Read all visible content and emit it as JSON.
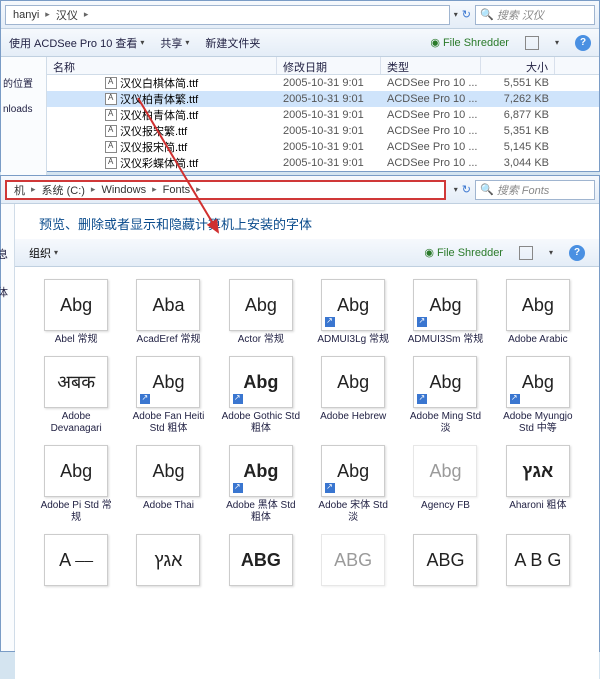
{
  "win1": {
    "path": [
      "hanyi",
      "汉仪"
    ],
    "search_placeholder": "搜索 汉仪",
    "toolbar": {
      "acd": "使用 ACDSee Pro 10 查看",
      "share": "共享",
      "new_folder": "新建文件夹",
      "shredder": "File Shredder"
    },
    "cols": {
      "name": "名称",
      "date": "修改日期",
      "type": "类型",
      "size": "大小"
    },
    "files": [
      {
        "name": "汉仪白棋体简.ttf",
        "date": "2005-10-31 9:01",
        "type": "ACDSee Pro 10 ...",
        "size": "5,551 KB",
        "sel": false
      },
      {
        "name": "汉仪柏青体繁.ttf",
        "date": "2005-10-31 9:01",
        "type": "ACDSee Pro 10 ...",
        "size": "7,262 KB",
        "sel": true
      },
      {
        "name": "汉仪柏青体简.ttf",
        "date": "2005-10-31 9:01",
        "type": "ACDSee Pro 10 ...",
        "size": "6,877 KB",
        "sel": false
      },
      {
        "name": "汉仪报宋繁.ttf",
        "date": "2005-10-31 9:01",
        "type": "ACDSee Pro 10 ...",
        "size": "5,351 KB",
        "sel": false
      },
      {
        "name": "汉仪报宋简.ttf",
        "date": "2005-10-31 9:01",
        "type": "ACDSee Pro 10 ...",
        "size": "5,145 KB",
        "sel": false
      },
      {
        "name": "汉仪彩蝶体简.ttf",
        "date": "2005-10-31 9:01",
        "type": "ACDSee Pro 10 ...",
        "size": "3,044 KB",
        "sel": false
      }
    ],
    "sidebar": [
      "的位置",
      "nloads"
    ]
  },
  "win2": {
    "path": [
      "机",
      "系统 (C:)",
      "Windows",
      "Fonts"
    ],
    "search_placeholder": "搜索 Fonts",
    "title": "预览、删除或者显示和隐藏计算机上安装的字体",
    "toolbar": {
      "organize": "组织",
      "shredder": "File Shredder"
    },
    "sidebar": [
      "息",
      "体"
    ],
    "fonts": [
      {
        "sample": "Abg",
        "name": "Abel 常规"
      },
      {
        "sample": "Aba",
        "name": "AcadEref 常规"
      },
      {
        "sample": "Abg",
        "name": "Actor 常规"
      },
      {
        "sample": "Abg",
        "name": "ADMUI3Lg 常规",
        "sc": true
      },
      {
        "sample": "Abg",
        "name": "ADMUI3Sm 常规",
        "sc": true
      },
      {
        "sample": "Abg",
        "name": "Adobe Arabic"
      },
      {
        "sample": "अबक",
        "name": "Adobe Devanagari"
      },
      {
        "sample": "Abg",
        "name": "Adobe Fan Heiti Std 粗体",
        "sc": true
      },
      {
        "sample": "Abg",
        "name": "Adobe Gothic Std 粗体",
        "sc": true,
        "bold": true
      },
      {
        "sample": "Abg",
        "name": "Adobe Hebrew"
      },
      {
        "sample": "Abg",
        "name": "Adobe Ming Std 淡",
        "sc": true
      },
      {
        "sample": "Abg",
        "name": "Adobe Myungjo Std 中等",
        "sc": true
      },
      {
        "sample": "Abg",
        "name": "Adobe Pi Std 常规"
      },
      {
        "sample": "Abg",
        "name": "Adobe Thai"
      },
      {
        "sample": "Abg",
        "name": "Adobe 黑体 Std 粗体",
        "sc": true,
        "bold": true
      },
      {
        "sample": "Abg",
        "name": "Adobe 宋体 Std 淡",
        "sc": true
      },
      {
        "sample": "Abg",
        "name": "Agency FB",
        "fade": true
      },
      {
        "sample": "אגץ",
        "name": "Aharoni 粗体",
        "bold": true
      },
      {
        "sample": "A ⎯⎯",
        "name": ""
      },
      {
        "sample": "אגץ",
        "name": ""
      },
      {
        "sample": "ABG",
        "name": "",
        "bold": true
      },
      {
        "sample": "ABG",
        "name": "",
        "fade": true
      },
      {
        "sample": "ABG",
        "name": ""
      },
      {
        "sample": "A B G",
        "name": ""
      }
    ]
  }
}
